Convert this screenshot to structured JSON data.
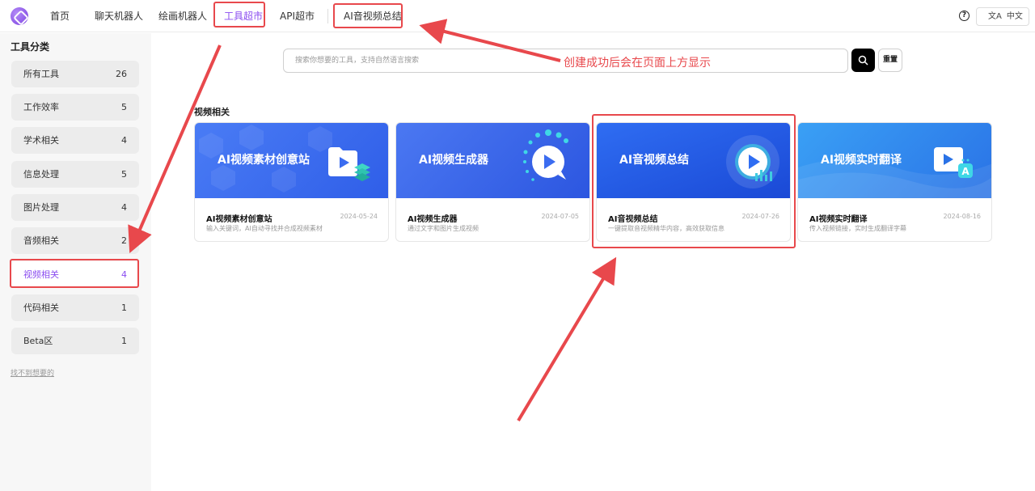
{
  "nav": {
    "items": [
      "首页",
      "聊天机器人",
      "绘画机器人",
      "工具超市",
      "API超市",
      "AI音视频总结"
    ],
    "active_index": 3,
    "lang_label": "中文",
    "lang_icon": "文A"
  },
  "sidebar": {
    "title": "工具分类",
    "categories": [
      {
        "label": "所有工具",
        "count": "26"
      },
      {
        "label": "工作效率",
        "count": "5"
      },
      {
        "label": "学术相关",
        "count": "4"
      },
      {
        "label": "信息处理",
        "count": "5"
      },
      {
        "label": "图片处理",
        "count": "4"
      },
      {
        "label": "音频相关",
        "count": "2"
      },
      {
        "label": "视频相关",
        "count": "4"
      },
      {
        "label": "代码相关",
        "count": "1"
      },
      {
        "label": "Beta区",
        "count": "1"
      }
    ],
    "active_index": 6,
    "not_found_link": "找不到想要的"
  },
  "search": {
    "placeholder": "搜索你想要的工具，支持自然语言搜索",
    "reset_label": "重置"
  },
  "section": {
    "title": "视频相关"
  },
  "tools": [
    {
      "banner_title": "AI视频素材创意站",
      "name": "AI视频素材创意站",
      "date": "2024-05-24",
      "desc": "输入关键词，AI自动寻找并合成视频素材",
      "icon": "folder-play-icon"
    },
    {
      "banner_title": "AI视频生成器",
      "name": "AI视频生成器",
      "date": "2024-07-05",
      "desc": "通过文字和图片生成视频",
      "icon": "play-bubble-icon"
    },
    {
      "banner_title": "AI音视频总结",
      "name": "AI音视频总结",
      "date": "2024-07-26",
      "desc": "一键提取音视频精华内容，高效获取信息",
      "icon": "play-circle-icon"
    },
    {
      "banner_title": "AI视频实时翻译",
      "name": "AI视频实时翻译",
      "date": "2024-08-16",
      "desc": "传入视频链接，实时生成翻译字幕",
      "icon": "translate-play-icon"
    }
  ],
  "annotation": {
    "text": "创建成功后会在页面上方显示",
    "color": "#e8484c"
  },
  "colors": {
    "accent": "#8a4cf0",
    "annotation": "#e8484c"
  }
}
